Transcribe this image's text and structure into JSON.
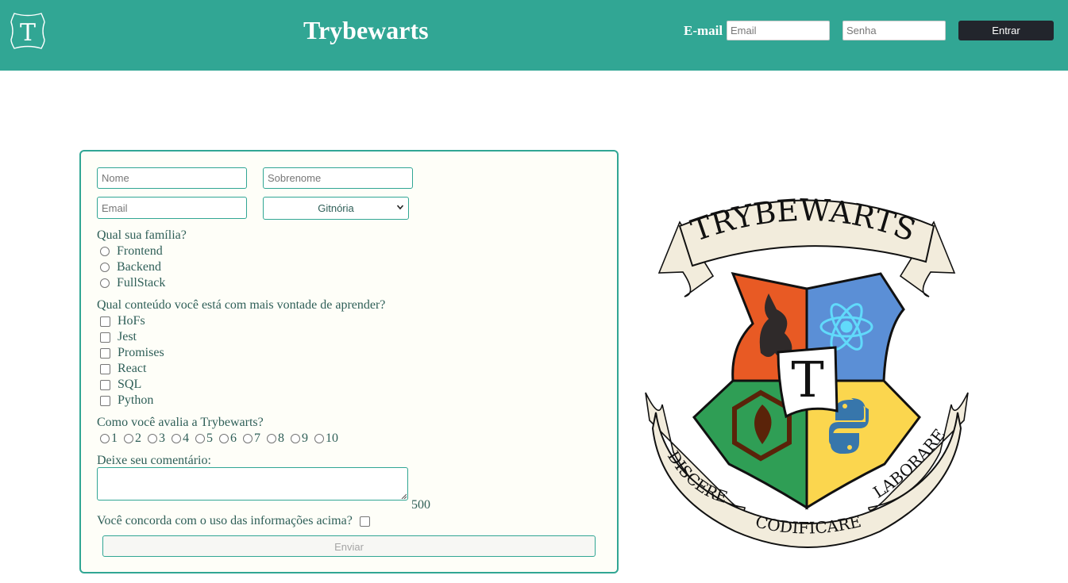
{
  "header": {
    "title": "Trybewarts",
    "logo_letter": "T",
    "login_label": "E-mail",
    "email_placeholder": "Email",
    "password_placeholder": "Senha",
    "enter_button": "Entrar",
    "bg_color": "#31a694"
  },
  "form": {
    "name_placeholder": "Nome",
    "lastname_placeholder": "Sobrenome",
    "email_placeholder": "Email",
    "house_selected": "Gitnória",
    "family_question": "Qual sua família?",
    "family_options": [
      "Frontend",
      "Backend",
      "FullStack"
    ],
    "content_question": "Qual conteúdo você está com mais vontade de aprender?",
    "content_options": [
      "HoFs",
      "Jest",
      "Promises",
      "React",
      "SQL",
      "Python"
    ],
    "rate_question": "Como você avalia a Trybewarts?",
    "rate_options": [
      "1",
      "2",
      "3",
      "4",
      "5",
      "6",
      "7",
      "8",
      "9",
      "10"
    ],
    "comment_label": "Deixe seu comentário:",
    "char_counter": "500",
    "agreement_label": "Você concorda com o uso das informações acima?",
    "submit_button": "Enviar"
  },
  "crest": {
    "banner_top": "TRYBEWARTS",
    "center_letter": "T",
    "motto": [
      "DISCERE",
      "CODIFICARE",
      "LABORARE"
    ],
    "quadrant_colors": [
      "#e85a24",
      "#5b8fd6",
      "#2f9e55",
      "#fbd64e"
    ]
  }
}
